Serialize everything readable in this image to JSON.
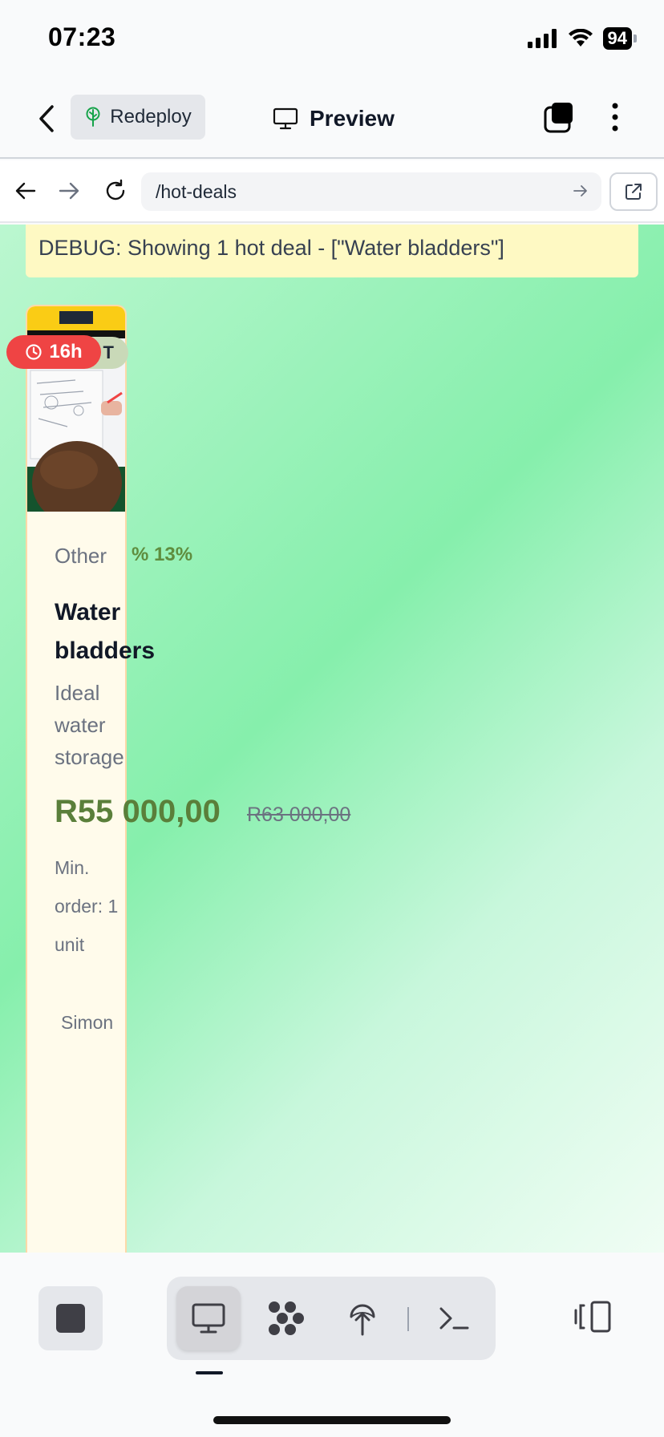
{
  "status_bar": {
    "time": "07:23",
    "battery": "94"
  },
  "header": {
    "redeploy_label": "Redeploy",
    "title": "Preview"
  },
  "url_bar": {
    "value": "/hot-deals"
  },
  "debug": {
    "text": "DEBUG: Showing 1 hot deal - [\"Water bladders\"]"
  },
  "deal": {
    "timer": "16h",
    "hot_badge": "T",
    "category": "Other",
    "discount": "% 13%",
    "title": "Water bladders",
    "description": "Ideal water storage",
    "price": "R55 000,00",
    "old_price": "R63 000,00",
    "min_order": "Min. order: 1 unit",
    "seller": "Simon"
  },
  "icons": {
    "back": "chevron-left-icon",
    "redeploy": "tree-icon",
    "preview": "monitor-icon",
    "tabs": "tabs-icon",
    "more": "more-vertical-icon",
    "nav_back": "arrow-left-icon",
    "nav_forward": "arrow-right-icon",
    "reload": "reload-icon",
    "go": "arrow-right-icon",
    "external": "external-link-icon",
    "stop": "stop-icon",
    "mode_preview": "monitor-icon",
    "mode_graph": "nodes-icon",
    "mode_deploy": "tree-upload-icon",
    "mode_terminal": "terminal-icon",
    "panel": "panel-icon"
  },
  "colors": {
    "timer_badge": "#ef4444",
    "price": "#5a7f3a",
    "debug_bg": "#fef9c3",
    "card_bg": "#fffbeb"
  }
}
